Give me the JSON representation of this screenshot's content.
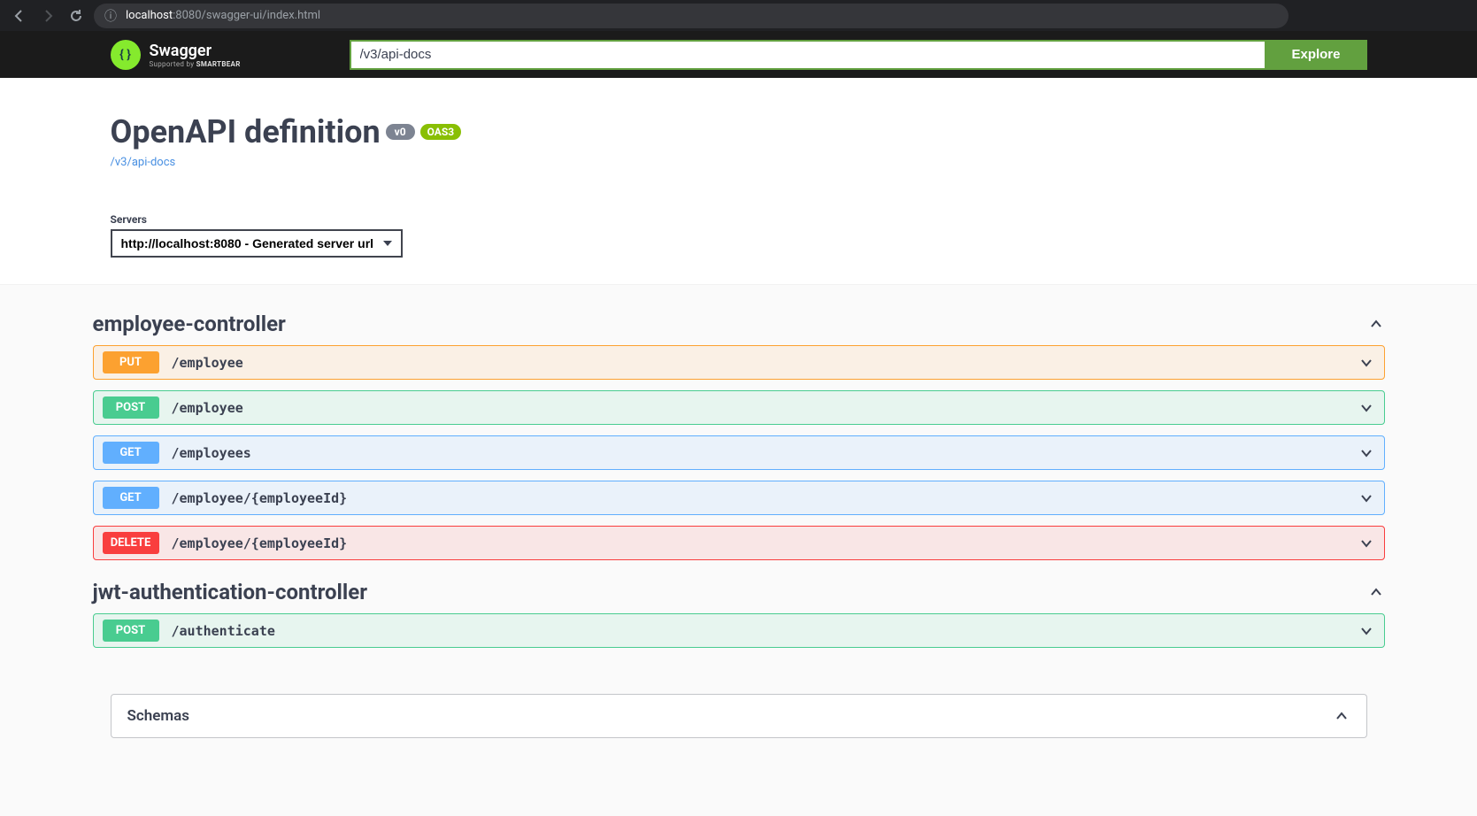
{
  "browser": {
    "url_host": "localhost",
    "url_port_path": ":8080/swagger-ui/index.html"
  },
  "topbar": {
    "brand": "Swagger",
    "support_prefix": "Supported by ",
    "support_brand": "SMARTBEAR",
    "explore_input_value": "/v3/api-docs",
    "explore_btn_label": "Explore"
  },
  "info": {
    "title": "OpenAPI definition",
    "version_badge": "v0",
    "oas_badge": "OAS3",
    "api_docs_link": "/v3/api-docs"
  },
  "servers": {
    "label": "Servers",
    "selected": "http://localhost:8080 - Generated server url"
  },
  "tags": [
    {
      "name": "employee-controller",
      "operations": [
        {
          "method": "PUT",
          "path": "/employee",
          "cls": "op-put"
        },
        {
          "method": "POST",
          "path": "/employee",
          "cls": "op-post"
        },
        {
          "method": "GET",
          "path": "/employees",
          "cls": "op-get"
        },
        {
          "method": "GET",
          "path": "/employee/{employeeId}",
          "cls": "op-get"
        },
        {
          "method": "DELETE",
          "path": "/employee/{employeeId}",
          "cls": "op-delete"
        }
      ]
    },
    {
      "name": "jwt-authentication-controller",
      "operations": [
        {
          "method": "POST",
          "path": "/authenticate",
          "cls": "op-post"
        }
      ]
    }
  ],
  "schemas": {
    "label": "Schemas"
  }
}
